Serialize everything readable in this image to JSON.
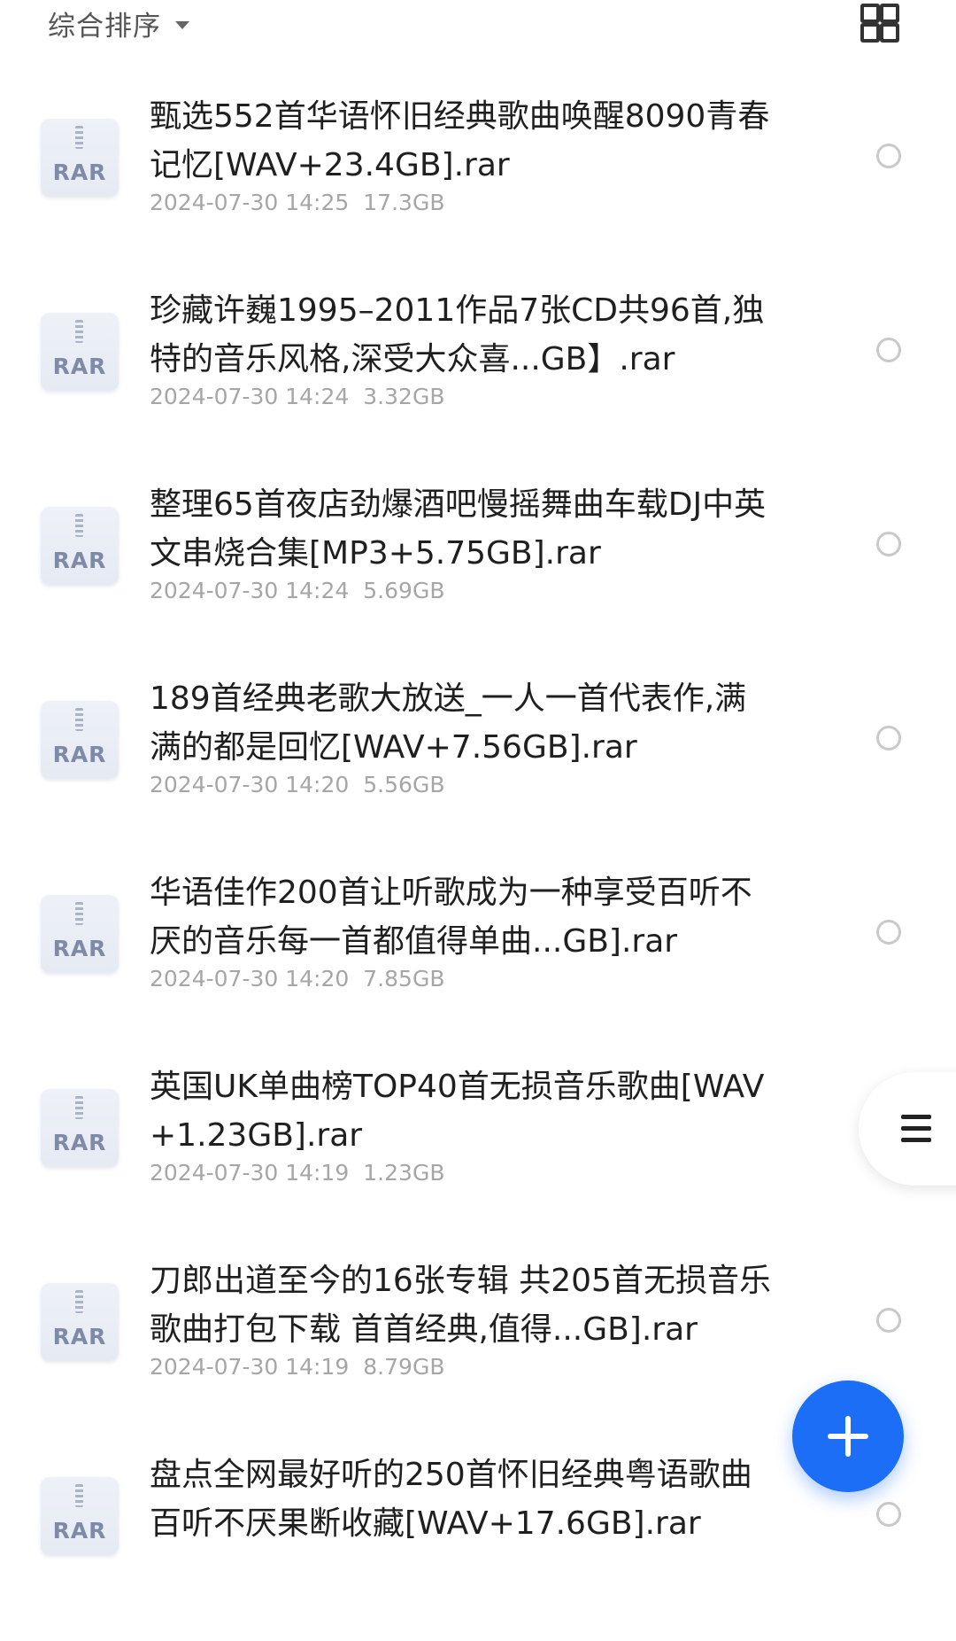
{
  "toolbar": {
    "sort_label": "综合排序",
    "sort_icon": "chevron-down-icon",
    "view_toggle_icon": "grid-view-icon"
  },
  "files": [
    {
      "name": "甄选552首华语怀旧经典歌曲唤醒8090青春记忆[WAV+23.4GB].rar",
      "date": "2024-07-30 14:25",
      "size": "17.3GB",
      "type": "RAR"
    },
    {
      "name": "珍藏许巍1995–2011作品7张CD共96首,独特的音乐风格,深受大众喜...GB】.rar",
      "date": "2024-07-30 14:24",
      "size": "3.32GB",
      "type": "RAR"
    },
    {
      "name": "整理65首夜店劲爆酒吧慢摇舞曲车载DJ中英文串烧合集[MP3+5.75GB].rar",
      "date": "2024-07-30 14:24",
      "size": "5.69GB",
      "type": "RAR"
    },
    {
      "name": "189首经典老歌大放送_一人一首代表作,满满的都是回忆[WAV+7.56GB].rar",
      "date": "2024-07-30 14:20",
      "size": "5.56GB",
      "type": "RAR"
    },
    {
      "name": "华语佳作200首让听歌成为一种享受百听不厌的音乐每一首都值得单曲...GB].rar",
      "date": "2024-07-30 14:20",
      "size": "7.85GB",
      "type": "RAR"
    },
    {
      "name": "英国UK单曲榜TOP40首无损音乐歌曲[WAV+1.23GB].rar",
      "date": "2024-07-30 14:19",
      "size": "1.23GB",
      "type": "RAR"
    },
    {
      "name": "刀郎出道至今的16张专辑 共205首无损音乐歌曲打包下载 首首经典,值得...GB].rar",
      "date": "2024-07-30 14:19",
      "size": "8.79GB",
      "type": "RAR"
    },
    {
      "name": "盘点全网最好听的250首怀旧经典粤语歌曲 百听不厌果断收藏[WAV+17.6GB].rar",
      "date": "",
      "size": "",
      "type": "RAR"
    }
  ],
  "side_menu": {
    "icon": "hamburger-menu-icon"
  },
  "fab": {
    "icon": "plus-icon",
    "accent_color": "#1b6ef5"
  }
}
